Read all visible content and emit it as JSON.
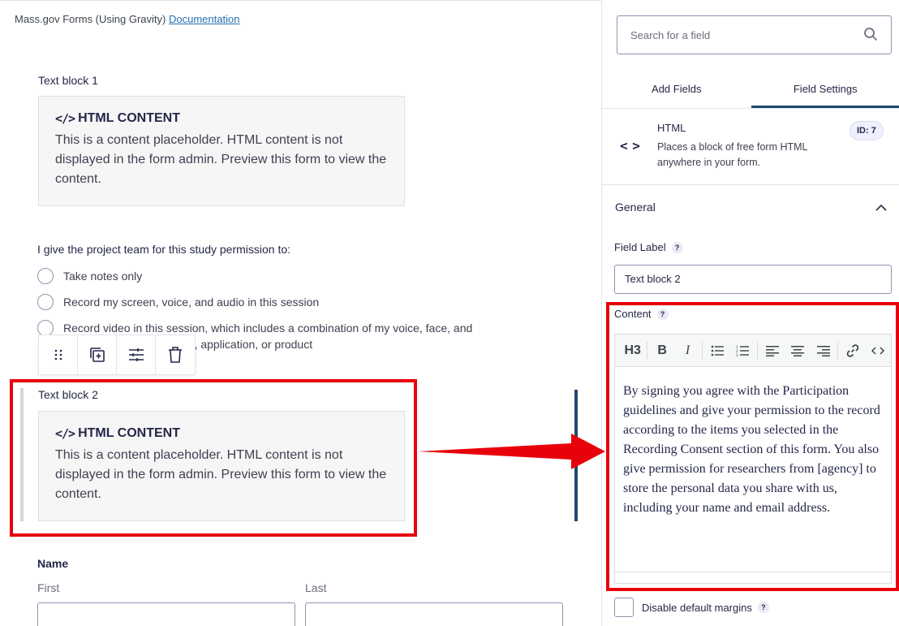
{
  "breadcrumb": {
    "text": "Mass.gov Forms (Using Gravity)",
    "link": "Documentation"
  },
  "text_block_1": {
    "label": "Text block 1",
    "title": "HTML CONTENT",
    "body": "This is a content placeholder. HTML content is not displayed in the form admin. Preview this form to view the content."
  },
  "permission": {
    "question": "I give the project team for this study permission to:",
    "options": [
      "Take notes only",
      "Record my screen, voice, and audio in this session",
      "Record video in this session, which includes a combination of my voice, face, and",
      "osite, application, or product"
    ]
  },
  "text_block_2": {
    "label": "Text block 2",
    "title": "HTML CONTENT",
    "body": "This is a content placeholder. HTML content is not displayed in the form admin. Preview this form to view the content."
  },
  "name_field": {
    "label": "Name",
    "first": "First",
    "last": "Last"
  },
  "sidebar": {
    "search_placeholder": "Search for a field",
    "tabs": [
      "Add Fields",
      "Field Settings"
    ],
    "field": {
      "title": "HTML",
      "description": "Places a block of free form HTML anywhere in your form.",
      "id": "ID: 7"
    },
    "section": "General",
    "field_label": "Field Label",
    "field_label_value": "Text block 2",
    "content_label": "Content",
    "content_value": "By signing you agree with the Participation guidelines and give your permission to the record according to the items you selected in the Recording Consent section of this form. You also give permission for researchers from [agency] to store the personal data you share with us, including your name and email address.",
    "editor_h3": "H3",
    "help_mark": "?",
    "disable_margins": "Disable default margins"
  },
  "colors": {
    "highlight": "#e8000b",
    "accent": "#1f4970"
  }
}
